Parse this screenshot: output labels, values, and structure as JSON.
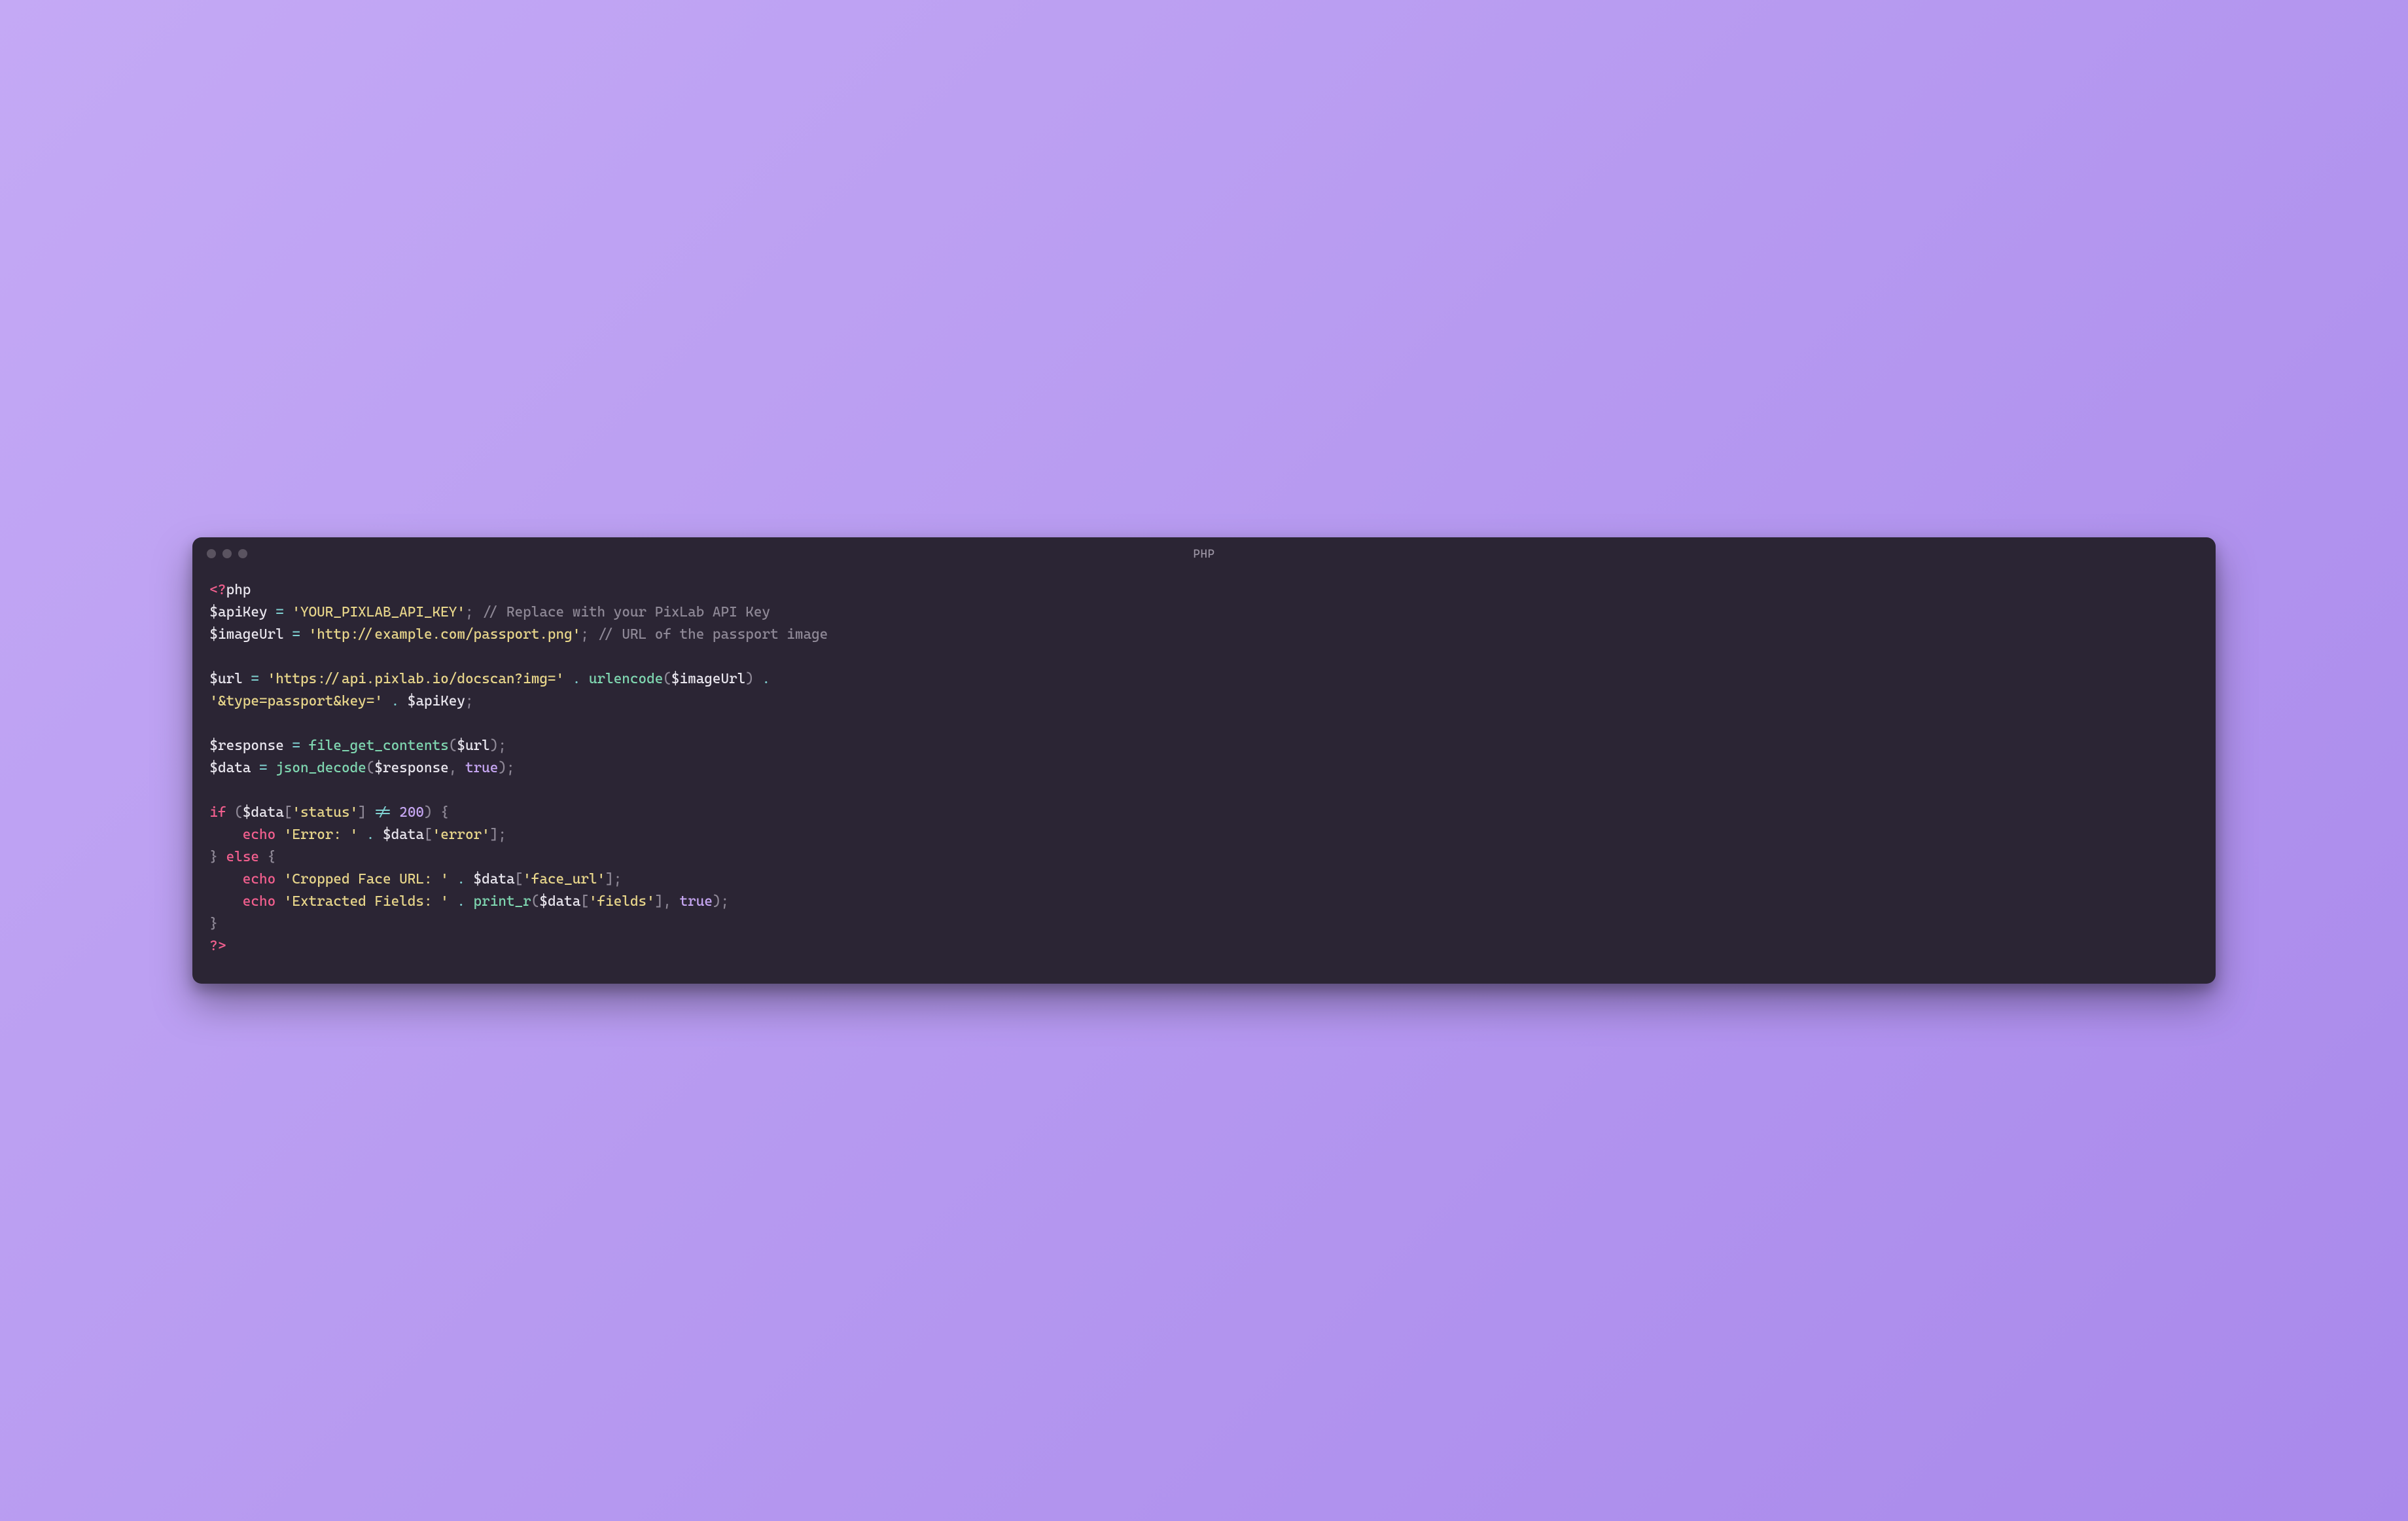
{
  "window": {
    "title": "PHP"
  },
  "code": {
    "line1": {
      "open_tag_a": "<?",
      "open_tag_b": "php"
    },
    "line2": {
      "var": "$apiKey",
      "eq": " = ",
      "str": "'YOUR_PIXLAB_API_KEY'",
      "semi": ";",
      "sp": " ",
      "comment": "// Replace with your PixLab API Key"
    },
    "line3": {
      "var": "$imageUrl",
      "eq": " = ",
      "str": "'http://example.com/passport.png'",
      "semi": ";",
      "sp": " ",
      "comment": "// URL of the passport image"
    },
    "line5": {
      "var": "$url",
      "eq": " = ",
      "str": "'https://api.pixlab.io/docscan?img='",
      "concat1": " . ",
      "fn": "urlencode",
      "lp": "(",
      "arg": "$imageUrl",
      "rp": ")",
      "concat2": " . "
    },
    "line6": {
      "str": "'&type=passport&key='",
      "concat": " . ",
      "var": "$apiKey",
      "semi": ";"
    },
    "line8": {
      "var": "$response",
      "eq": " = ",
      "fn": "file_get_contents",
      "lp": "(",
      "arg": "$url",
      "rp": ")",
      "semi": ";"
    },
    "line9": {
      "var": "$data",
      "eq": " = ",
      "fn": "json_decode",
      "lp": "(",
      "arg1": "$response",
      "comma": ", ",
      "arg2": "true",
      "rp": ")",
      "semi": ";"
    },
    "line11": {
      "kw": "if",
      "sp": " ",
      "lp": "(",
      "var": "$data",
      "lb": "[",
      "key": "'status'",
      "rb": "]",
      "ne": " != ",
      "num": "200",
      "rp": ")",
      "sp2": " ",
      "brace": "{"
    },
    "line12": {
      "indent": "    ",
      "kw": "echo",
      "sp": " ",
      "str": "'Error: '",
      "concat": " . ",
      "var": "$data",
      "lb": "[",
      "key": "'error'",
      "rb": "]",
      "semi": ";"
    },
    "line13": {
      "brace": "}",
      "sp": " ",
      "kw": "else",
      "sp2": " ",
      "brace2": "{"
    },
    "line14": {
      "indent": "    ",
      "kw": "echo",
      "sp": " ",
      "str": "'Cropped Face URL: '",
      "concat": " . ",
      "var": "$data",
      "lb": "[",
      "key": "'face_url'",
      "rb": "]",
      "semi": ";"
    },
    "line15": {
      "indent": "    ",
      "kw": "echo",
      "sp": " ",
      "str": "'Extracted Fields: '",
      "concat": " . ",
      "fn": "print_r",
      "lp": "(",
      "var": "$data",
      "lb": "[",
      "key": "'fields'",
      "rb": "]",
      "comma": ", ",
      "bool": "true",
      "rp": ")",
      "semi": ";"
    },
    "line16": {
      "brace": "}"
    },
    "line17": {
      "close": "?>"
    }
  }
}
